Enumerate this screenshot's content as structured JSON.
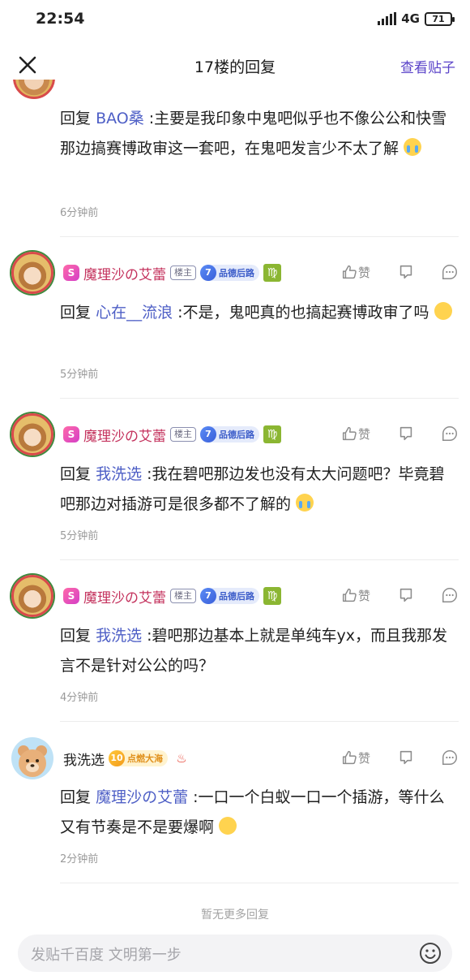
{
  "status_bar": {
    "time": "22:54",
    "network": "4G",
    "battery": "71"
  },
  "nav": {
    "title": "17楼的回复",
    "view_post": "查看贴子"
  },
  "replies": [
    {
      "reply_word": "回复",
      "mention": "BAO桑",
      "text": ":主要是我印象中鬼吧似乎也不像公公和快雪那边搞赛博政审这一套吧，在鬼吧发言少不太了解",
      "time": "6分钟前"
    },
    {
      "user": "魔理沙の艾蕾",
      "s_badge": "S",
      "lz_badge": "楼主",
      "level": "7",
      "level_name": "品德后路",
      "zodiac": "♍",
      "reply_word": "回复",
      "mention": "心在__流浪",
      "text": ":不是，鬼吧真的也搞起赛博政审了吗",
      "time": "5分钟前",
      "like_label": "赞"
    },
    {
      "user": "魔理沙の艾蕾",
      "s_badge": "S",
      "lz_badge": "楼主",
      "level": "7",
      "level_name": "品德后路",
      "zodiac": "♍",
      "reply_word": "回复",
      "mention": "我洗选",
      "text": ":我在碧吧那边发也没有太大问题吧？毕竟碧吧那边对插游可是很多都不了解的",
      "time": "5分钟前",
      "like_label": "赞"
    },
    {
      "user": "魔理沙の艾蕾",
      "s_badge": "S",
      "lz_badge": "楼主",
      "level": "7",
      "level_name": "品德后路",
      "zodiac": "♍",
      "reply_word": "回复",
      "mention": "我洗选",
      "text": ":碧吧那边基本上就是单纯车yx，而且我那发言不是针对公公的吗？",
      "time": "4分钟前",
      "like_label": "赞"
    },
    {
      "user": "我洗选",
      "level": "10",
      "level_name": "点燃大海",
      "reply_word": "回复",
      "mention": "魔理沙の艾蕾",
      "text": ":一口一个白蚁一口一个插游，等什么又有节奏是不是要爆啊",
      "time": "2分钟前",
      "like_label": "赞"
    }
  ],
  "footer": {
    "no_more": "暂无更多回复",
    "input_placeholder": "发贴千百度 文明第一步"
  }
}
